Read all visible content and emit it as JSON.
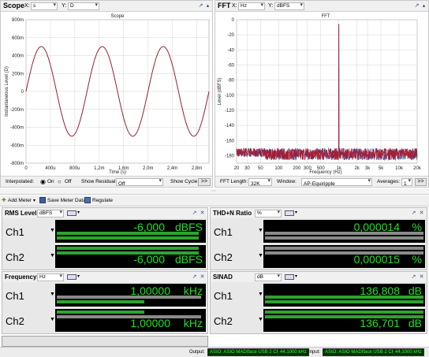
{
  "scope": {
    "title": "Scope",
    "x_label": "X:",
    "x_unit": "s",
    "y_label": "Y:",
    "y_unit": "D",
    "plot_title": "Scope",
    "ylabel": "Instantaneous Level (D)",
    "xlabel": "Time (s)",
    "yticks": [
      "800m",
      "600m",
      "400m",
      "200m",
      "0",
      "-200m",
      "-400m",
      "-600m",
      "-800m"
    ],
    "xticks": [
      "0",
      "400u",
      "800u",
      "1,2m",
      "1,6m",
      "2,0m",
      "2,4m",
      "2,8m"
    ],
    "interpolated_label": "Interpolated:",
    "on_label": "On",
    "off_label": "Off",
    "interpolated_value": "On",
    "residual_label": "Show Residual:",
    "residual_value": "Off",
    "cycle_label": "Show Cycle",
    "more_label": ">>"
  },
  "fft": {
    "title": "FFT",
    "x_label": "X:",
    "x_unit": "Hz",
    "y_label": "Y:",
    "y_unit": "dBFS",
    "plot_title": "FFT",
    "ylabel": "Level (dBFS)",
    "xlabel": "Frequency (Hz)",
    "yticks": [
      "0",
      "-20",
      "-40",
      "-60",
      "-80",
      "-100",
      "-120",
      "-140",
      "-160",
      "-180"
    ],
    "xticks": [
      "20",
      "30",
      "50",
      "100",
      "200",
      "300",
      "500",
      "1k",
      "2k",
      "3k",
      "5k",
      "10k",
      "20k"
    ],
    "length_label": "FFT Length:",
    "length_value": "32K",
    "window_label": "Window:",
    "window_value": "AP-Equiripple",
    "averages_label": "Averages:",
    "averages_value": "1",
    "more_label": ">>"
  },
  "toolbar": {
    "add_meter": "Add Meter",
    "save_meter": "Save Meter Data",
    "regulate": "Regulate"
  },
  "meters": [
    {
      "title": "RMS Level",
      "unit_select": "dBFS",
      "rows": [
        {
          "ch": "Ch1",
          "value": "-6,000",
          "unit": "dBFS"
        },
        {
          "ch": "Ch2",
          "value": "-6,000",
          "unit": "dBFS"
        }
      ]
    },
    {
      "title": "THD+N Ratio",
      "unit_select": "%",
      "rows": [
        {
          "ch": "Ch1",
          "value": "0,000014",
          "unit": "%"
        },
        {
          "ch": "Ch2",
          "value": "0,000015",
          "unit": "%"
        }
      ]
    },
    {
      "title": "Frequency",
      "unit_select": "Hz",
      "rows": [
        {
          "ch": "Ch1",
          "value": "1,00000",
          "unit": "kHz"
        },
        {
          "ch": "Ch2",
          "value": "1,00000",
          "unit": "kHz"
        }
      ]
    },
    {
      "title": "SINAD",
      "unit_select": "dB",
      "rows": [
        {
          "ch": "Ch1",
          "value": "136,808",
          "unit": "dB"
        },
        {
          "ch": "Ch2",
          "value": "136,701",
          "unit": "dB"
        }
      ]
    }
  ],
  "status": {
    "output_label": "Output:",
    "output_device": "ASIO: ASIO MADIface USB 2 Chs",
    "output_rate": "44,1000 kHz",
    "input_label": "Input:",
    "input_device": "ASIO: ASIO MADIface USB 2 Chs",
    "input_rate": "44,1000 kHz"
  },
  "chart_data": [
    {
      "type": "line",
      "title": "Scope",
      "xlabel": "Time (s)",
      "ylabel": "Instantaneous Level (D)",
      "xlim": [
        0,
        0.003
      ],
      "ylim": [
        -0.8,
        0.8
      ],
      "series": [
        {
          "function": "0.5*sin(2*pi*1000*t)",
          "frequency_hz": 1000,
          "amplitude": 0.5
        }
      ],
      "grid": true,
      "color": "#9b2030"
    },
    {
      "type": "line",
      "title": "FFT",
      "xlabel": "Frequency (Hz)",
      "ylabel": "Level (dBFS)",
      "xlim": [
        20,
        20000
      ],
      "x_scale": "log",
      "ylim": [
        -190,
        0
      ],
      "series": [
        {
          "name": "Ch1",
          "peak": {
            "x": 1000,
            "y": -6
          },
          "noise_floor": -178,
          "color": "#b01c2e"
        },
        {
          "name": "Ch2",
          "peak": {
            "x": 1000,
            "y": -6
          },
          "noise_floor": -178,
          "color": "#2c3c8a"
        }
      ],
      "grid": true
    }
  ]
}
